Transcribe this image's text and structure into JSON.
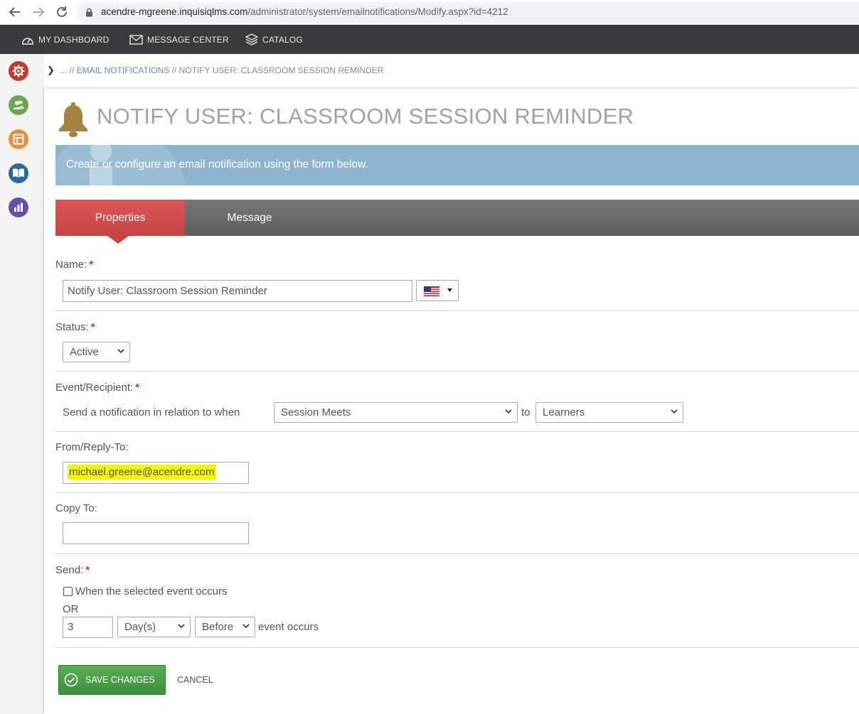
{
  "browser": {
    "url_host": "acendre-mgreene.inquisiqlms.com",
    "url_path": "/administrator/system/emailnotifications/Modify.aspx?id=4212"
  },
  "topnav": {
    "items": [
      {
        "label": "MY DASHBOARD",
        "icon": "dashboard-icon"
      },
      {
        "label": "MESSAGE CENTER",
        "icon": "envelope-icon"
      },
      {
        "label": "CATALOG",
        "icon": "catalog-icon"
      }
    ]
  },
  "rail": {
    "icons": [
      {
        "name": "system-settings-icon",
        "color": "#c0392b"
      },
      {
        "name": "users-groups-icon",
        "color": "#6aa84f"
      },
      {
        "name": "interface-layout-icon",
        "color": "#e69138"
      },
      {
        "name": "learning-assets-icon",
        "color": "#2b6a9e"
      },
      {
        "name": "reporting-icon",
        "color": "#674ea7"
      }
    ]
  },
  "breadcrumb": {
    "chevron": "❯",
    "ellipsis": "... //",
    "link": "EMAIL NOTIFICATIONS",
    "current": "// NOTIFY USER: CLASSROOM SESSION REMINDER"
  },
  "page": {
    "title": "NOTIFY USER: CLASSROOM SESSION REMINDER",
    "info": "Create or configure an email notification using the form below."
  },
  "tabs": [
    {
      "label": "Properties",
      "active": true
    },
    {
      "label": "Message",
      "active": false
    }
  ],
  "form": {
    "name": {
      "label": "Name:",
      "value": "Notify User: Classroom Session Reminder",
      "language": "en-US"
    },
    "status": {
      "label": "Status:",
      "selected": "Active"
    },
    "event": {
      "label": "Event/Recipient:",
      "prefix": "Send a notification in relation to when",
      "event_selected": "Session Meets",
      "joiner": "to",
      "recipient_selected": "Learners"
    },
    "from": {
      "label": "From/Reply-To:",
      "value": "michael.greene@acendre.com"
    },
    "copy_to": {
      "label": "Copy To:",
      "value": ""
    },
    "send": {
      "label": "Send:",
      "checkbox_label": "When the selected event occurs",
      "checked": false,
      "or_text": "OR",
      "interval_value": "3",
      "unit_selected": "Day(s)",
      "timing_selected": "Before",
      "suffix": "event occurs"
    }
  },
  "buttons": {
    "save": "SAVE CHANGES",
    "cancel": "CANCEL"
  },
  "colors": {
    "nav_bg": "#3a3a3c",
    "tab_active": "#d04a4a",
    "info_banner": "#8db4cd",
    "save_green": "#4a9e47",
    "highlight": "#f6f600",
    "bell": "#a3843e"
  }
}
